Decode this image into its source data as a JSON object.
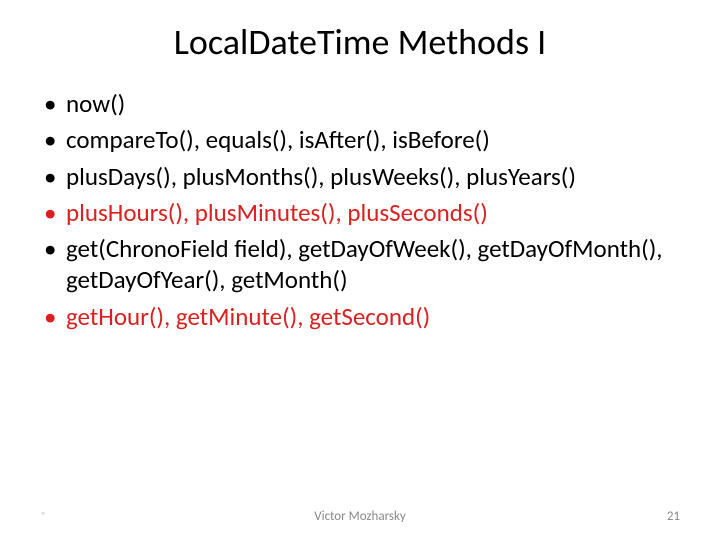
{
  "title": "LocalDateTime Methods I",
  "bullets": [
    {
      "text": "now()",
      "red": false
    },
    {
      "text": "compareTo(), equals(), isAfter(), isBefore()",
      "red": false
    },
    {
      "text": "plusDays(), plusMonths(), plusWeeks(), plusYears()",
      "red": false
    },
    {
      "text": "plusHours(), plusMinutes(), plusSeconds()",
      "red": true
    },
    {
      "text": "get(ChronoField field), getDayOfWeek(), getDayOfMonth(), getDayOfYear(), getMonth()",
      "red": false
    },
    {
      "text": " getHour(), getMinute(), getSecond()",
      "red": true
    }
  ],
  "footer": {
    "left_mark": "*",
    "author": "Victor Mozharsky",
    "page": "21"
  }
}
